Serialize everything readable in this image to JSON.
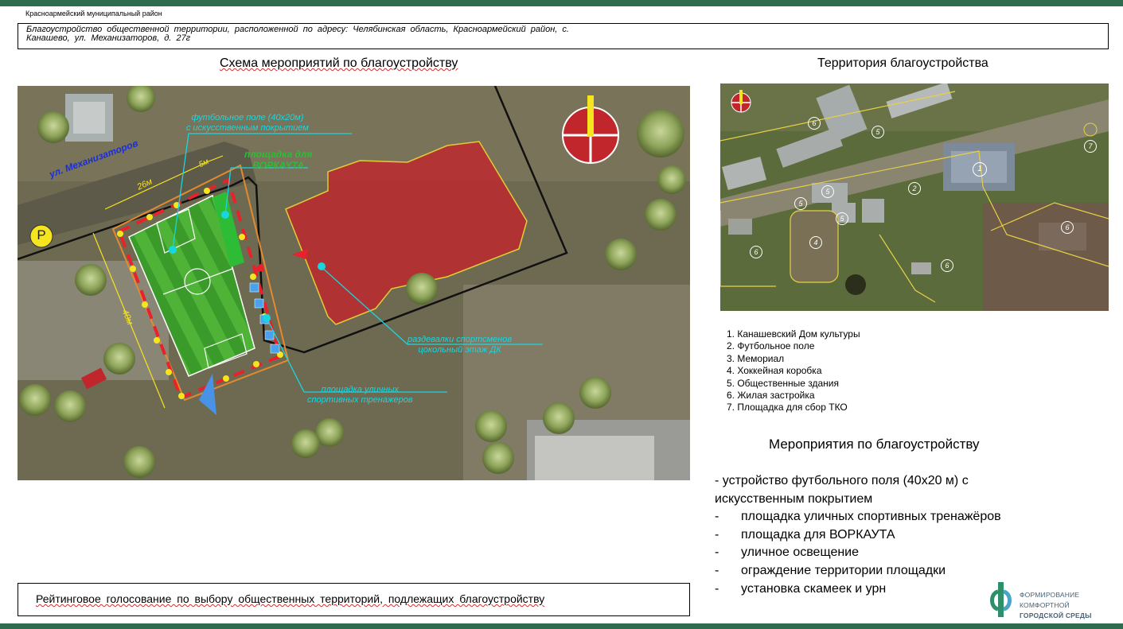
{
  "header": {
    "district": "Красноармейский муниципальный район",
    "address_line1": "Благоустройство общественной территории, расположенной по адресу: Челябинская область, Красноармейский район, с.",
    "address_line2": "Канашево, ул. Механизаторов, д. 27г"
  },
  "scheme": {
    "title": "Схема мероприятий по благоустройству",
    "labels": {
      "street": "ул. Механизаторов",
      "dim_26": "26м",
      "dim_5": "5м",
      "dim_40": "40м",
      "parking": "P",
      "football_line1": "футбольное поле (40х20м)",
      "football_line2": "с искусственным покрытием",
      "workout_line1": "площадка для",
      "workout_line2": "ВОРКАУТА",
      "locker_line1": "раздевалки спортсменов",
      "locker_line2": "цокольный этаж ДК",
      "trainers_line1": "площадка уличных",
      "trainers_line2": "спортивных тренажеров"
    }
  },
  "territory": {
    "title": "Территория благоустройства",
    "markers": [
      "6",
      "5",
      "1",
      "7",
      "2",
      "5",
      "5",
      "5",
      "4",
      "6",
      "6",
      "6"
    ]
  },
  "legend": [
    "1. Канашевский Дом культуры",
    "2. Футбольное поле",
    "3. Мемориал",
    "4. Хоккейная коробка",
    "5. Общественные здания",
    "6. Жилая застройка",
    "7. Площадка для сбор ТКО"
  ],
  "measures": {
    "title": "Мероприятия по благоустройству",
    "first": "- устройство  футбольного поля (40х20 м) с искусственным покрытием",
    "items": [
      "площадка уличных спортивных тренажёров",
      "площадка для ВОРКАУТА",
      "уличное освещение",
      "ограждение территории площадки",
      "установка скамеек и урн"
    ],
    "dash": "-"
  },
  "footer": {
    "rating": "Рейтинговое  голосование  по выбору общественных  территорий,  подлежащих  благоустройству"
  },
  "logo": {
    "line1": "ФОРМИРОВАНИЕ",
    "line2": "КОМФОРТНОЙ",
    "line3": "ГОРОДСКОЙ СРЕДЫ"
  },
  "colors": {
    "brand_green": "#2e6b4f",
    "building_red": "#c0262c",
    "field_green": "#3f9a2c",
    "annotation_cyan": "#18d6e0",
    "street_label_blue": "#1b2fd6"
  }
}
